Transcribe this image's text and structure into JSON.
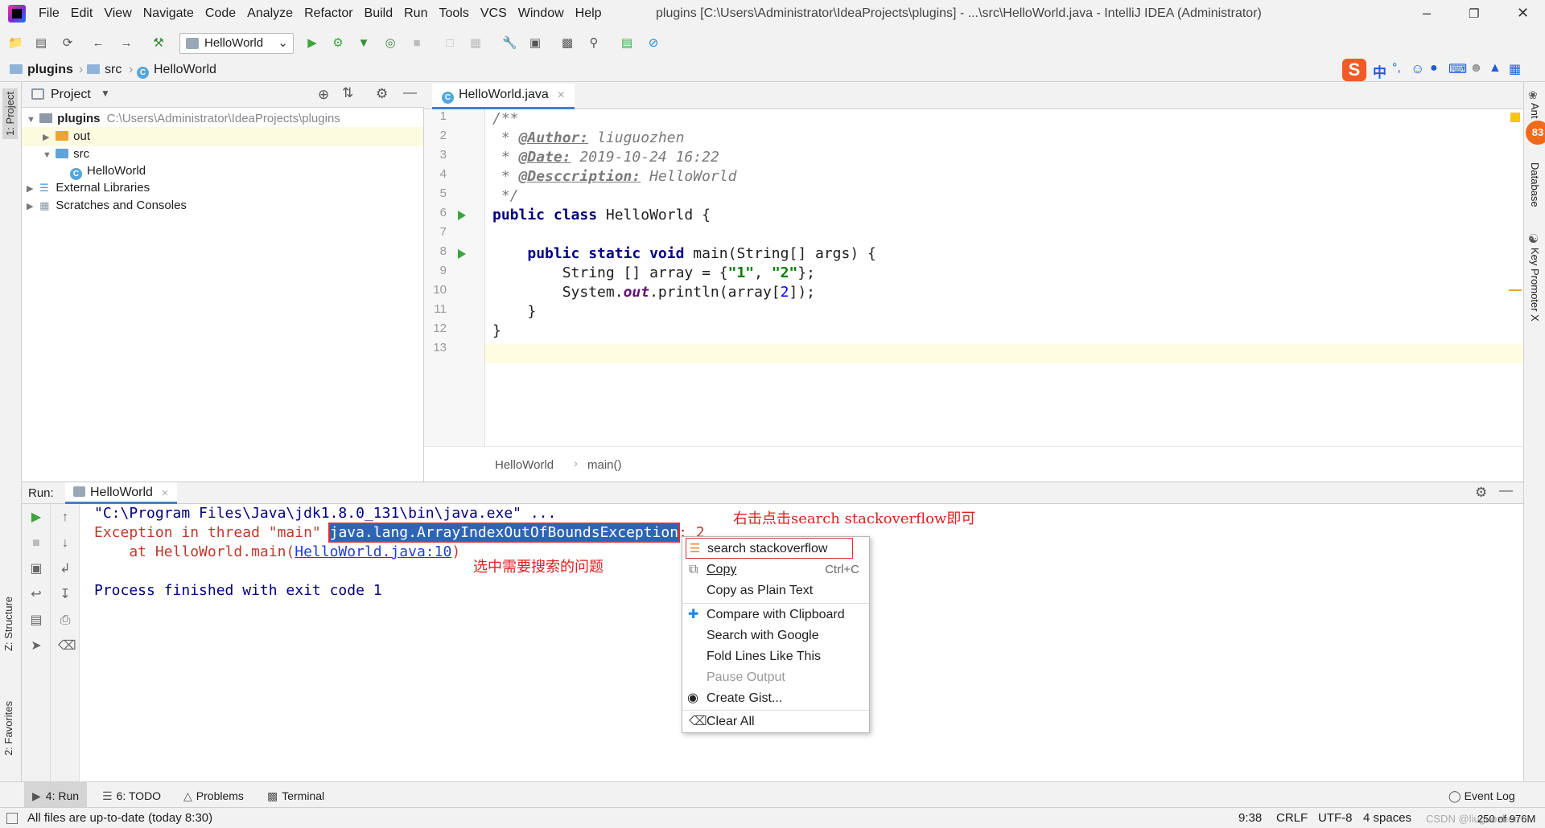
{
  "window": {
    "title": "plugins [C:\\Users\\Administrator\\IdeaProjects\\plugins] - ...\\src\\HelloWorld.java - IntelliJ IDEA (Administrator)",
    "menus": [
      "File",
      "Edit",
      "View",
      "Navigate",
      "Code",
      "Analyze",
      "Refactor",
      "Build",
      "Run",
      "Tools",
      "VCS",
      "Window",
      "Help"
    ]
  },
  "toolbar": {
    "run_config": "HelloWorld"
  },
  "breadcrumb": {
    "project": "plugins",
    "folder": "src",
    "file": "HelloWorld"
  },
  "project_panel": {
    "title": "Project",
    "tree": {
      "root_name": "plugins",
      "root_path": "C:\\Users\\Administrator\\IdeaProjects\\plugins",
      "out": "out",
      "src": "src",
      "class": "HelloWorld",
      "libraries": "External Libraries",
      "scratches": "Scratches and Consoles"
    }
  },
  "editor": {
    "tab": "HelloWorld.java",
    "line_numbers": [
      "1",
      "2",
      "3",
      "4",
      "5",
      "6",
      "7",
      "8",
      "9",
      "10",
      "11",
      "12",
      "13"
    ],
    "author_tag": "@Author:",
    "author": "liuguozhen",
    "date_tag": "@Date:",
    "date": "2019-10-24 16:22",
    "desc_tag": "@Desccription:",
    "desc": "HelloWorld",
    "crumb_class": "HelloWorld",
    "crumb_method": "main()"
  },
  "run_panel": {
    "label": "Run:",
    "tab": "HelloWorld",
    "cmd_line": "\"C:\\Program Files\\Java\\jdk1.8.0_131\\bin\\java.exe\" ...",
    "exception_prefix": "Exception in thread \"main\" ",
    "exception_class": "java.lang.ArrayIndexOutOfBoundsException",
    "exception_suffix": ": 2",
    "at_prefix": "    at HelloWorld.main(",
    "at_link": "HelloWorld.java:10",
    "at_suffix": ")",
    "process_finished": "Process finished with exit code 1",
    "annotation_right": "右击点击search stackoverflow即可",
    "annotation_below": "选中需要搜索的问题"
  },
  "context_menu": {
    "items": [
      {
        "label": "search stackoverflow"
      },
      {
        "label": "Copy",
        "shortcut": "Ctrl+C"
      },
      {
        "label": "Copy as Plain Text"
      },
      {
        "label": "Compare with Clipboard"
      },
      {
        "label": "Search with Google"
      },
      {
        "label": "Fold Lines Like This"
      },
      {
        "label": "Pause Output"
      },
      {
        "label": "Create Gist..."
      },
      {
        "label": "Clear All"
      }
    ]
  },
  "side_tabs": {
    "project": "1: Project",
    "structure": "Z: Structure",
    "favorites": "2: Favorites",
    "ant": "Ant",
    "database": "Database",
    "key_promoter": "Key Promoter X",
    "badge": "83"
  },
  "bottom_tabs": {
    "run": "4: Run",
    "todo": "6: TODO",
    "problems": "Problems",
    "terminal": "Terminal",
    "event_log": "Event Log"
  },
  "status_bar": {
    "message": "All files are up-to-date (today 8:30)",
    "position": "9:38",
    "line_sep": "CRLF",
    "encoding": "UTF-8",
    "indent": "4 spaces",
    "memory": "250 of 976M",
    "watermark": "CSDN @liuguozhen"
  },
  "colors": {
    "accent": "#4083c9",
    "keyword": "#000080",
    "string": "#007e00",
    "error": "#e02020"
  }
}
